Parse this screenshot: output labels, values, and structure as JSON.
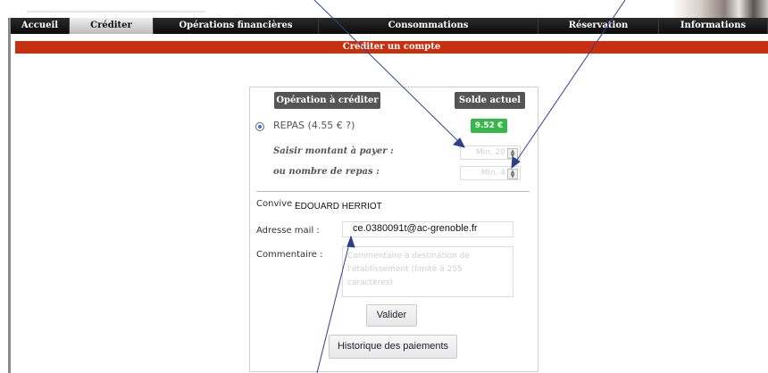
{
  "nav": {
    "items": [
      {
        "label": "Accueil"
      },
      {
        "label": "Créditer"
      },
      {
        "label": "Opérations financières"
      },
      {
        "label": "Consommations"
      },
      {
        "label": "Réservation"
      },
      {
        "label": "Informations"
      }
    ],
    "active_index": 1
  },
  "page": {
    "header_title": "Créditer un compte"
  },
  "form": {
    "operation_header": "Opération à créditer",
    "balance_header": "Solde actuel",
    "repas_label": "REPAS (4.55 € ?)",
    "balance_value": "9.52 €",
    "amount_label": "Saisir montant à payer :",
    "amount_placeholder": "Min. 20",
    "meals_label": "ou nombre de repas :",
    "meals_placeholder": "Min. 4",
    "convive_label": "Convive :",
    "convive_value": "EDOUARD HERRIOT",
    "email_label": "Adresse mail :",
    "email_value": "ce.0380091t@ac-grenoble.fr",
    "comment_label": "Commentaire :",
    "comment_placeholder": "Commentaire à destination de l'établissement (limité à 255 caractères)",
    "submit_label": "Valider",
    "history_label": "Historique des paiements"
  },
  "colors": {
    "header_bar": "#c7300f",
    "balance_badge": "#35b74a",
    "nav_background": "#111111",
    "annotation_arrow": "#2f3f8f"
  }
}
